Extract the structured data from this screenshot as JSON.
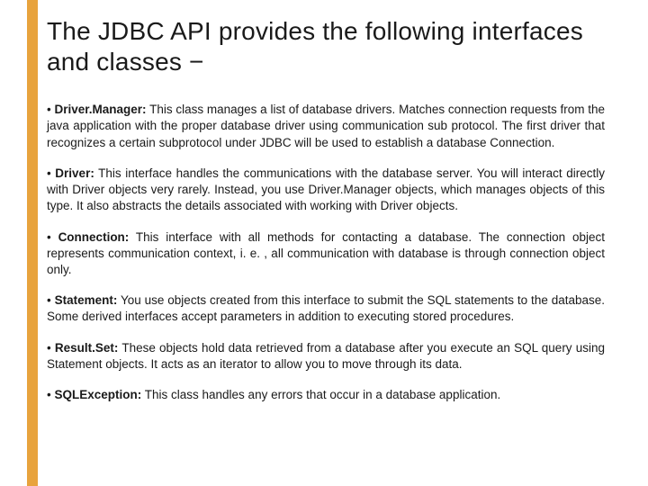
{
  "title": "The JDBC API provides the following interfaces and classes −",
  "items": [
    {
      "term": "Driver.Manager:",
      "desc": " This class manages a list of database drivers. Matches connection requests from the java application with the proper database driver using communication sub protocol. The first driver that recognizes a certain subprotocol under JDBC will be used to establish a database Connection."
    },
    {
      "term": "Driver:",
      "desc": " This interface handles the communications with the database server. You will interact directly with Driver objects very rarely. Instead, you use Driver.Manager objects, which manages objects of this type. It also abstracts the details associated with working with Driver objects."
    },
    {
      "term": "Connection:",
      "desc": " This interface with all methods for contacting a database. The connection object represents communication context, i. e. , all communication with database is through connection object only."
    },
    {
      "term": "Statement:",
      "desc": " You use objects created from this interface to submit the SQL statements to the database. Some derived interfaces accept parameters in addition to executing stored procedures."
    },
    {
      "term": "Result.Set:",
      "desc": " These objects hold data retrieved from a database after you execute an SQL query using Statement objects. It acts as an iterator to allow you to move through its data."
    },
    {
      "term": "SQLException:",
      "desc": " This class handles any errors that occur in a database application."
    }
  ]
}
